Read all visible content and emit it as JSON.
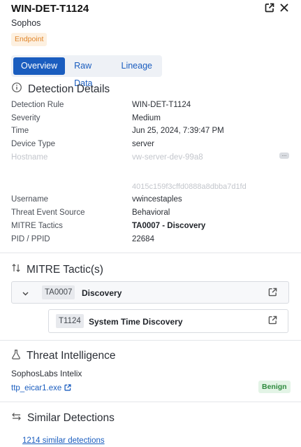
{
  "header": {
    "title": "WIN-DET-T1124",
    "vendor": "Sophos",
    "category_badge": "Endpoint"
  },
  "tabs": [
    {
      "label": "Overview",
      "active": true
    },
    {
      "label": "Raw Data",
      "active": false
    },
    {
      "label": "Lineage",
      "active": false
    }
  ],
  "detection_details": {
    "title": "Detection Details",
    "rows": [
      {
        "label": "Detection Rule",
        "value": "WIN-DET-T1124"
      },
      {
        "label": "Severity",
        "value": "Medium"
      },
      {
        "label": "Time",
        "value": "Jun 25, 2024, 7:39:47 PM"
      },
      {
        "label": "Device Type",
        "value": "server"
      },
      {
        "label": "Hostname",
        "value": "vw-server-dev-99a8"
      },
      {
        "label": "",
        "value": "4015c159f3cffd0888a8dbba7d1fd"
      },
      {
        "label": "Username",
        "value": "vwincestaples"
      },
      {
        "label": "Threat Event Source",
        "value": "Behavioral"
      },
      {
        "label": "MITRE Tactics",
        "value": "TA0007 - Discovery"
      },
      {
        "label": "PID / PPID",
        "value": "22684"
      }
    ],
    "more_indicator": "..."
  },
  "mitre": {
    "title": "MITRE Tactic(s)",
    "tactic": {
      "code": "TA0007",
      "name": "Discovery"
    },
    "technique": {
      "code": "T1124",
      "name": "System Time Discovery"
    }
  },
  "threat_intel": {
    "title": "Threat Intelligence",
    "provider": "SophosLabs Intelix",
    "file": "ttp_eicar1.exe",
    "verdict": "Benign",
    "verdict_color": "#2e8a3e"
  },
  "similar": {
    "title": "Similar Detections",
    "link": "1214 similar detections"
  },
  "colors": {
    "accent": "#1a5dbf",
    "endpoint_badge": "#e0852a"
  }
}
